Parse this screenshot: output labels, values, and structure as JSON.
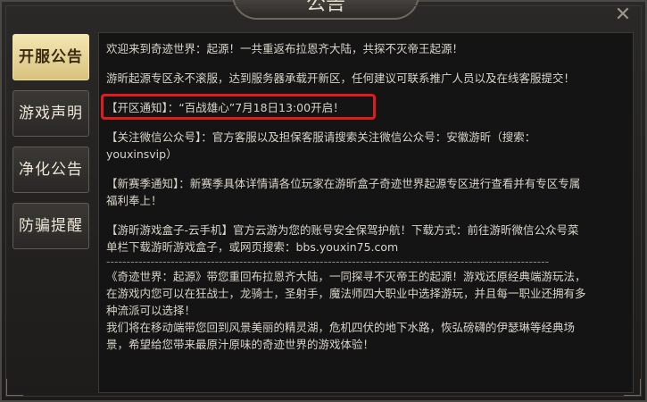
{
  "window": {
    "title": "公告",
    "close_glyph": "✕"
  },
  "tabs": [
    {
      "label": "开服公告",
      "active": true
    },
    {
      "label": "游戏声明",
      "active": false
    },
    {
      "label": "净化公告",
      "active": false
    },
    {
      "label": "防骗提醒",
      "active": false
    }
  ],
  "content": {
    "p1": "欢迎来到奇迹世界：起源！一共重返布拉恩齐大陆，共探不灭帝王起源！",
    "p2": "游昕起源专区永不滚服，达到服务器承载开新区，任何建议可联系推广人员以及在线客服提交！",
    "p3": "【开区通知】：“百战雄心”7月18日13:00开启！",
    "p4a": "【关注微信公众号】：官方客服以及担保客服请搜索关注微信公众号：安徽游昕（搜索：",
    "p4b": "youxinsvip）",
    "p5a": "【新赛季通知】：新赛季具体详情请各位玩家在游昕盒子奇迹世界起源专区进行查看并有专区专属",
    "p5b": "福利奉上！",
    "p6a": "【游昕游戏盒子-云手机】官方云游为您的账号安全保驾护航！下载方式：前往游昕微信公众号菜",
    "p6b": "单栏下载游昕游戏盒子，或网页搜索：bbs.youxin75.com",
    "divider": "--------------------------------------------------------------------------------------------------------------",
    "p7a": "《奇迹世界：起源》带您重回布拉恩齐大陆，一同探寻不灭帝王的起源！游戏还原经典端游玩法，",
    "p7b": "在游戏内您可以在狂战士，龙骑士，圣射手，魔法师四大职业中选择游玩，并且每一职业还拥有多",
    "p7c": "种流派可以选择！",
    "p7d": "我们将在移动端带您回到风景美丽的精灵湖，危机四伏的地下水路，恢弘磅礴的伊瑟琳等经典场",
    "p7e": "景，希望给您带来最原汁原味的奇迹世界的游戏体验！"
  },
  "colors": {
    "highlight_border": "#e11b1b",
    "active_tab": "#e8d494"
  }
}
